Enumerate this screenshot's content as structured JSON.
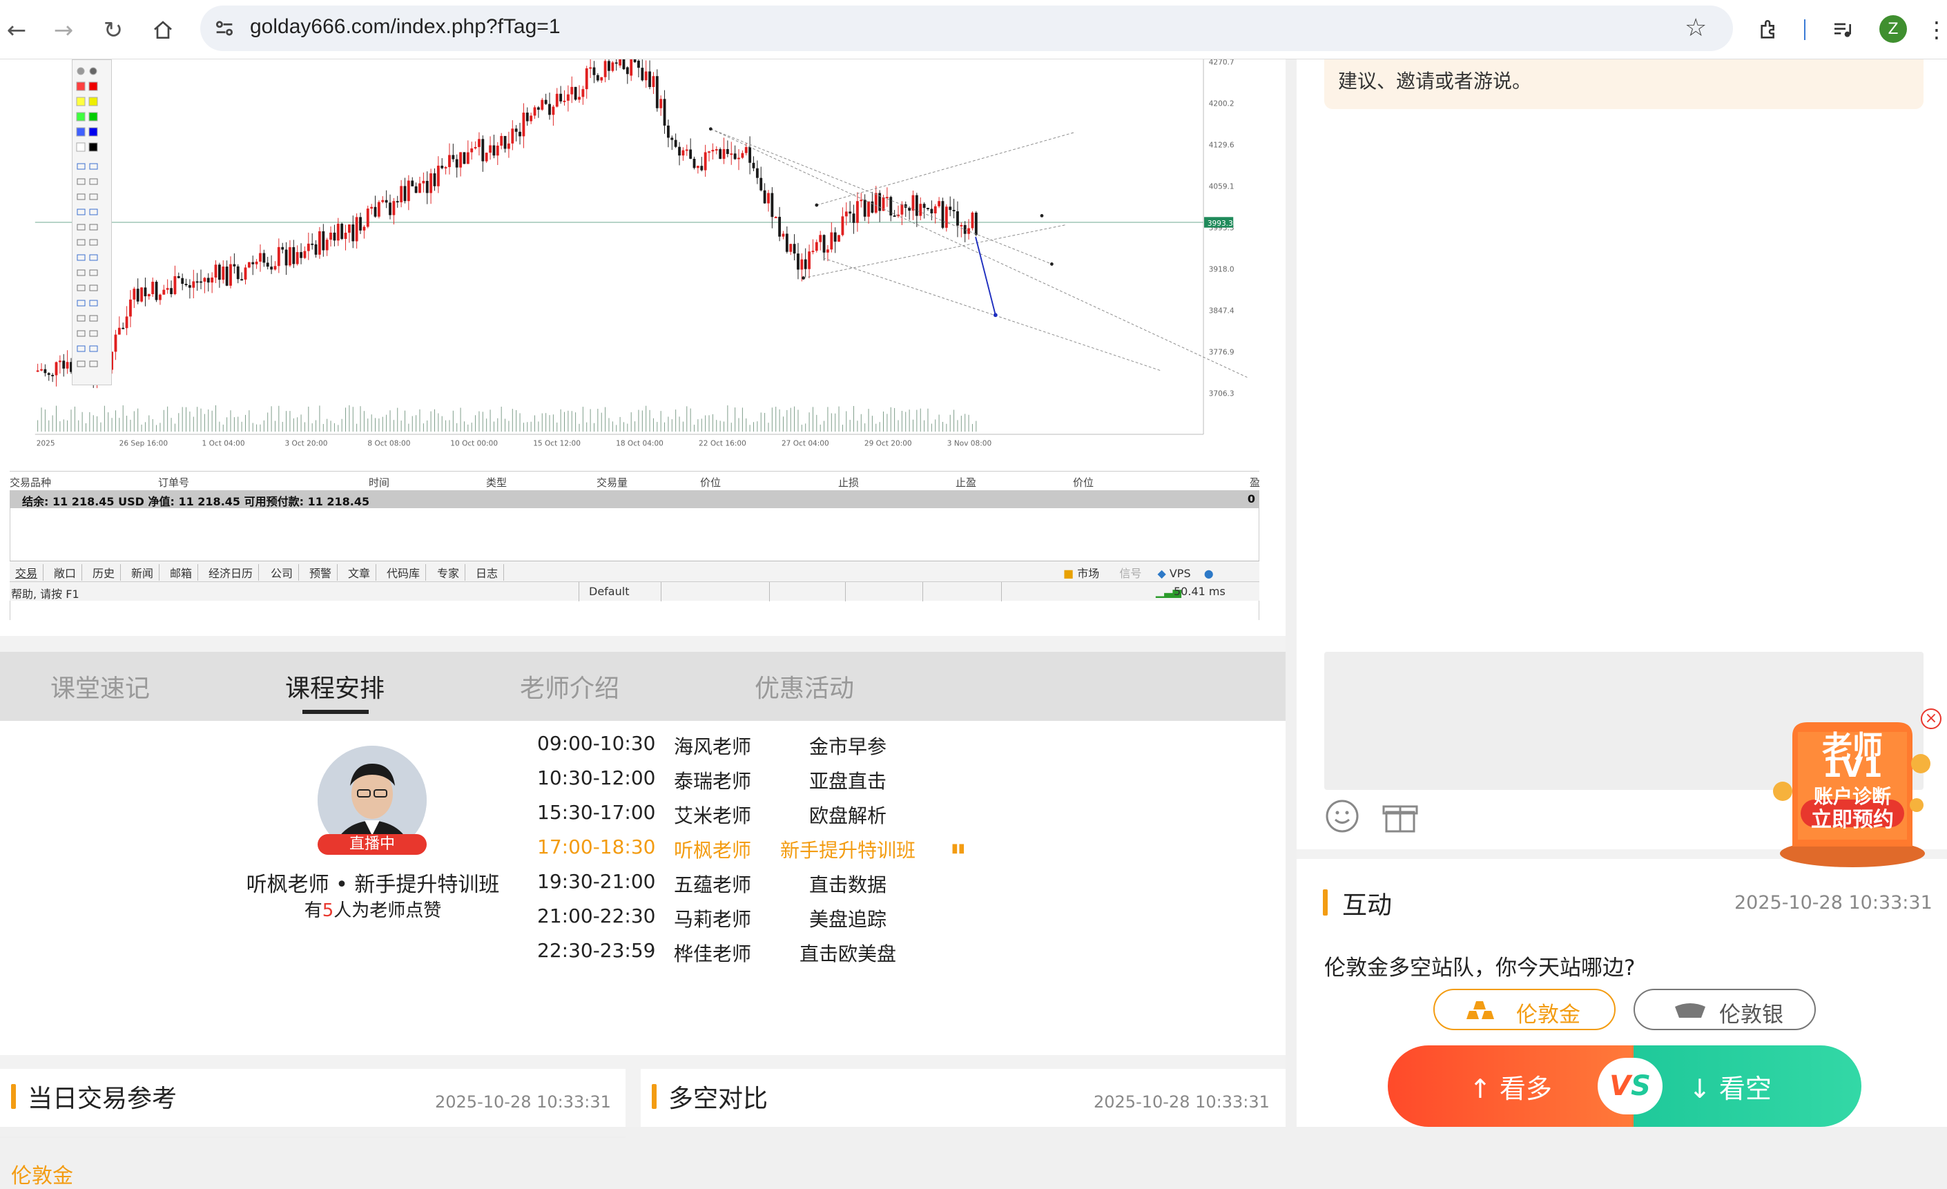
{
  "browser": {
    "url": "golday666.com/index.php?fTag=1",
    "profile_initial": "Z"
  },
  "chart": {
    "price_labels": [
      "4270.7",
      "4200.2",
      "4129.6",
      "4059.1",
      "3993.3",
      "3918.0",
      "3847.4",
      "3776.9",
      "3706.3"
    ],
    "current_price": "3993.3",
    "date_labels": [
      "2025",
      "26 Sep 16:00",
      "1 Oct 04:00",
      "3 Oct 20:00",
      "8 Oct 08:00",
      "10 Oct 00:00",
      "15 Oct 12:00",
      "18 Oct 04:00",
      "22 Oct 16:00",
      "27 Oct 04:00",
      "29 Oct 20:00",
      "3 Nov 08:00"
    ],
    "table_headers": [
      "交易品种",
      "订单号",
      "时间",
      "类型",
      "交易量",
      "价位",
      "止损",
      "止盈",
      "价位",
      "盈"
    ],
    "balance": "结余: 11 218.45 USD  净值: 11 218.45  可用预付款: 11 218.45",
    "balance_right": "0",
    "bottom_tabs": [
      "交易",
      "敞口",
      "历史",
      "新闻",
      "邮箱",
      "经济日历",
      "公司",
      "预警",
      "文章",
      "代码库",
      "专家",
      "日志"
    ],
    "status_left": "帮助, 请按 F1",
    "status_default": "Default",
    "status_market": "市场",
    "status_signal": "信号",
    "status_vps": "VPS",
    "status_ping": "50.41 ms"
  },
  "tabs": [
    "课堂速记",
    "课程安排",
    "老师介绍",
    "优惠活动"
  ],
  "active_tab": 1,
  "teacher": {
    "live_badge": "直播中",
    "name": "听枫老师 • 新手提升特训班",
    "likes_prefix": "有",
    "likes_count": "5",
    "likes_suffix": "人为老师点赞"
  },
  "schedule": [
    {
      "time": "09:00-10:30",
      "teacher": "海风老师",
      "topic": "金市早参",
      "active": false
    },
    {
      "time": "10:30-12:00",
      "teacher": "泰瑞老师",
      "topic": "亚盘直击",
      "active": false
    },
    {
      "time": "15:30-17:00",
      "teacher": "艾米老师",
      "topic": "欧盘解析",
      "active": false
    },
    {
      "time": "17:00-18:30",
      "teacher": "听枫老师",
      "topic": "新手提升特训班",
      "active": true
    },
    {
      "time": "19:30-21:00",
      "teacher": "五蕴老师",
      "topic": "直击数据",
      "active": false
    },
    {
      "time": "21:00-22:30",
      "teacher": "马莉老师",
      "topic": "美盘追踪",
      "active": false
    },
    {
      "time": "22:30-23:59",
      "teacher": "桦佳老师",
      "topic": "直击欧美盘",
      "active": false
    }
  ],
  "panels": {
    "daily": {
      "title": "当日交易参考",
      "date": "2025-10-28 10:33:31",
      "first_item": "伦敦金"
    },
    "longshort": {
      "title": "多空对比",
      "date": "2025-10-28 10:33:31"
    }
  },
  "right": {
    "notice": "建议、邀请或者游说。",
    "promo": {
      "line1": "老师",
      "line2": "1V1",
      "line3": "账户诊断",
      "line4": "立即预约"
    },
    "interact_title": "互动",
    "interact_date": "2025-10-28 10:33:31",
    "question": "伦敦金多空站队，你今天站哪边?",
    "option_gold": "伦敦金",
    "option_silver": "伦敦银",
    "bull": "看多",
    "bear": "看空",
    "vs": "VS"
  },
  "colors": {
    "accent": "#f39c12",
    "bull": "#ff5a2c",
    "bear": "#1fc99a",
    "up_candle": "#e02020",
    "down_candle": "#1a1a1a"
  }
}
